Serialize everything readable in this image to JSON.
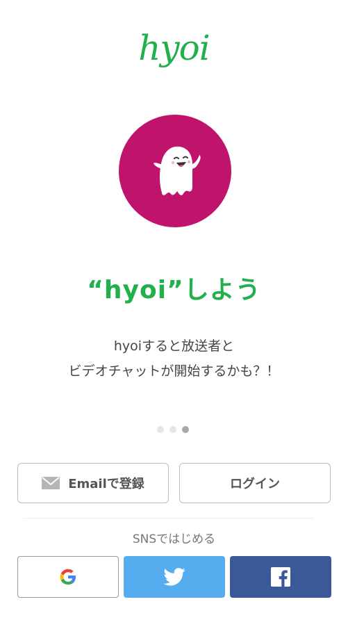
{
  "brand": {
    "logo_text": "hyoi",
    "logo_color": "#21b04b"
  },
  "hero": {
    "circle_color": "#c0136b",
    "icon": "ghost-icon"
  },
  "headline": "“hyoi”しよう",
  "description": {
    "line1": "hyoiすると放送者と",
    "line2": "ビデオチャットが開始するかも？！"
  },
  "pager": {
    "count": 3,
    "active_index": 2
  },
  "buttons": {
    "email_label": "Emailで登録",
    "email_icon": "envelope-icon",
    "login_label": "ログイン"
  },
  "sns": {
    "label": "SNSではじめる",
    "providers": [
      {
        "name": "Google",
        "icon": "google-icon",
        "color": "#ffffff"
      },
      {
        "name": "Twitter",
        "icon": "twitter-icon",
        "color": "#55acee"
      },
      {
        "name": "Facebook",
        "icon": "facebook-icon",
        "color": "#3b5998"
      }
    ]
  }
}
